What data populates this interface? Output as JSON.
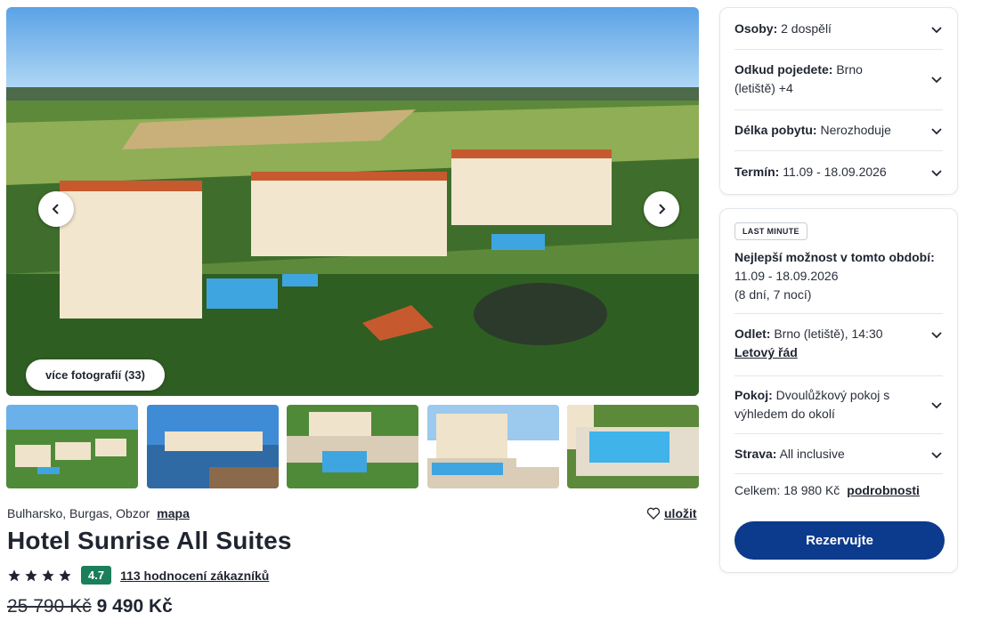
{
  "gallery": {
    "more_photos_label": "více fotografií (33)"
  },
  "hotel": {
    "location": "Bulharsko, Burgas, Obzor",
    "map_link": "mapa",
    "save_label": "uložit",
    "name": "Hotel Sunrise All Suites",
    "stars": 4,
    "rating": "4.7",
    "reviews_label": "113 hodnocení zákazníků",
    "old_price": "25 790 Kč",
    "new_price": "9 490 Kč"
  },
  "filters": {
    "persons": {
      "label": "Osoby:",
      "value": "2 dospělí"
    },
    "departure": {
      "label": "Odkud pojedete:",
      "value": "Brno (letiště) +4"
    },
    "length": {
      "label": "Délka pobytu:",
      "value": "Nerozhoduje"
    },
    "date": {
      "label": "Termín:",
      "value": "11.09 - 18.09.2026"
    }
  },
  "offer": {
    "badge": "LAST MINUTE",
    "best_label": "Nejlepší možnost v tomto období:",
    "best_dates": "11.09 - 18.09.2026",
    "best_length": "(8 dní, 7 nocí)",
    "flight": {
      "label": "Odlet:",
      "value": "Brno (letiště), 14:30",
      "link": "Letový řád"
    },
    "room": {
      "label": "Pokoj:",
      "value": "Dvoulůžkový pokoj s výhledem do okolí"
    },
    "board": {
      "label": "Strava:",
      "value": "All inclusive"
    },
    "total_label": "Celkem: 18 980 Kč",
    "details_link": "podrobnosti",
    "reserve_button": "Rezervujte"
  },
  "colors": {
    "primary_button": "#0c3a8c",
    "rating_badge": "#1a7f5a"
  }
}
